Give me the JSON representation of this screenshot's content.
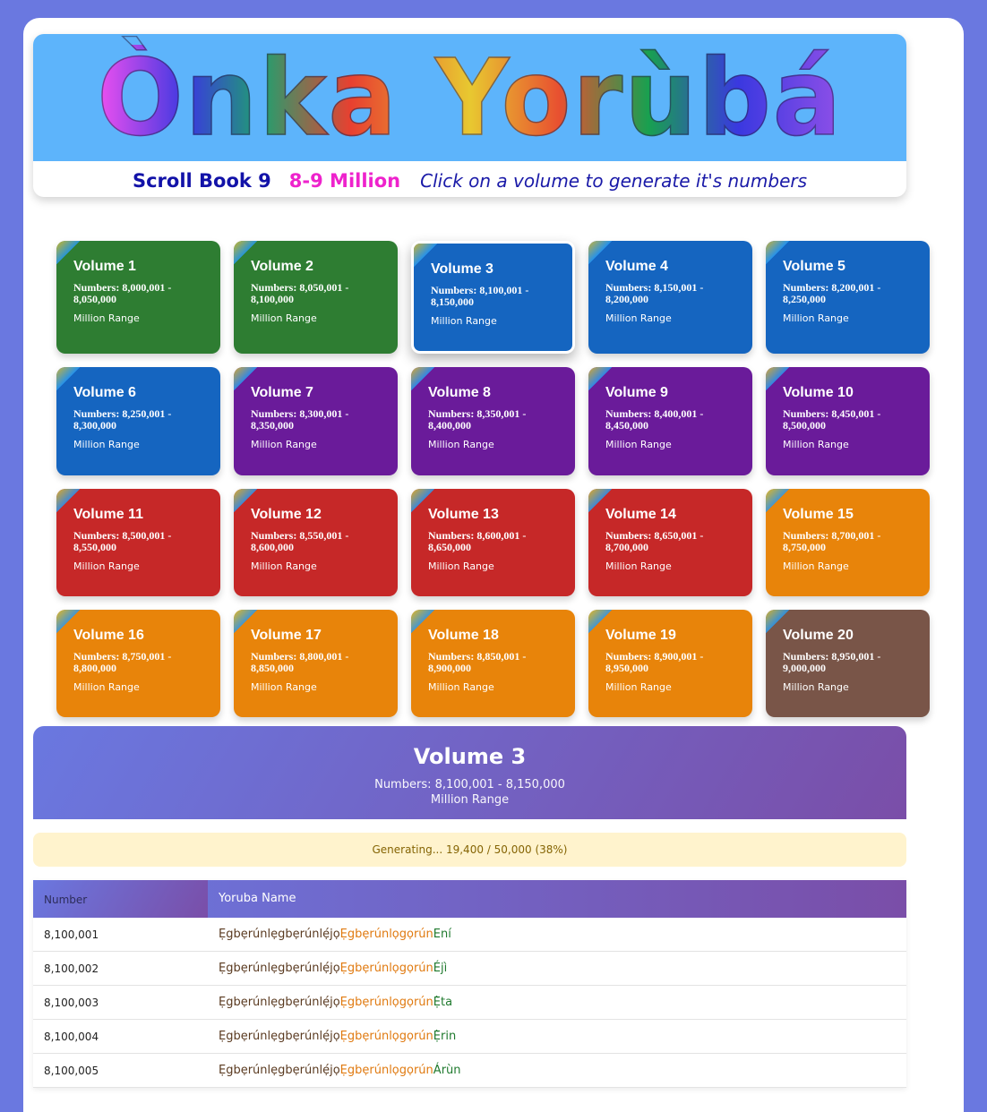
{
  "banner": {
    "logo": "Ònka Yorùbá",
    "book": "Scroll Book 9",
    "range": "8-9 Million",
    "instruction": "Click on a volume to generate it's numbers"
  },
  "volumes": [
    {
      "title": "Volume 1",
      "numbers": "Numbers: 8,000,001 - 8,050,000",
      "range": "Million Range",
      "color": "#2e7d32"
    },
    {
      "title": "Volume 2",
      "numbers": "Numbers: 8,050,001 - 8,100,000",
      "range": "Million Range",
      "color": "#2e7d32"
    },
    {
      "title": "Volume 3",
      "numbers": "Numbers: 8,100,001 - 8,150,000",
      "range": "Million Range",
      "color": "#1565c0"
    },
    {
      "title": "Volume 4",
      "numbers": "Numbers: 8,150,001 - 8,200,000",
      "range": "Million Range",
      "color": "#1565c0"
    },
    {
      "title": "Volume 5",
      "numbers": "Numbers: 8,200,001 - 8,250,000",
      "range": "Million Range",
      "color": "#1565c0"
    },
    {
      "title": "Volume 6",
      "numbers": "Numbers: 8,250,001 - 8,300,000",
      "range": "Million Range",
      "color": "#1565c0"
    },
    {
      "title": "Volume 7",
      "numbers": "Numbers: 8,300,001 - 8,350,000",
      "range": "Million Range",
      "color": "#6a1b9a"
    },
    {
      "title": "Volume 8",
      "numbers": "Numbers: 8,350,001 - 8,400,000",
      "range": "Million Range",
      "color": "#6a1b9a"
    },
    {
      "title": "Volume 9",
      "numbers": "Numbers: 8,400,001 - 8,450,000",
      "range": "Million Range",
      "color": "#6a1b9a"
    },
    {
      "title": "Volume 10",
      "numbers": "Numbers: 8,450,001 - 8,500,000",
      "range": "Million Range",
      "color": "#6a1b9a"
    },
    {
      "title": "Volume 11",
      "numbers": "Numbers: 8,500,001 - 8,550,000",
      "range": "Million Range",
      "color": "#c62828"
    },
    {
      "title": "Volume 12",
      "numbers": "Numbers: 8,550,001 - 8,600,000",
      "range": "Million Range",
      "color": "#c62828"
    },
    {
      "title": "Volume 13",
      "numbers": "Numbers: 8,600,001 - 8,650,000",
      "range": "Million Range",
      "color": "#c62828"
    },
    {
      "title": "Volume 14",
      "numbers": "Numbers: 8,650,001 - 8,700,000",
      "range": "Million Range",
      "color": "#c62828"
    },
    {
      "title": "Volume 15",
      "numbers": "Numbers: 8,700,001 - 8,750,000",
      "range": "Million Range",
      "color": "#e8840a"
    },
    {
      "title": "Volume 16",
      "numbers": "Numbers: 8,750,001 - 8,800,000",
      "range": "Million Range",
      "color": "#e8840a"
    },
    {
      "title": "Volume 17",
      "numbers": "Numbers: 8,800,001 - 8,850,000",
      "range": "Million Range",
      "color": "#e8840a"
    },
    {
      "title": "Volume 18",
      "numbers": "Numbers: 8,850,001 - 8,900,000",
      "range": "Million Range",
      "color": "#e8840a"
    },
    {
      "title": "Volume 19",
      "numbers": "Numbers: 8,900,001 - 8,950,000",
      "range": "Million Range",
      "color": "#e8840a"
    },
    {
      "title": "Volume 20",
      "numbers": "Numbers: 8,950,001 - 9,000,000",
      "range": "Million Range",
      "color": "#795548"
    }
  ],
  "selected_volume": {
    "title": "Volume 3",
    "numbers": "Numbers: 8,100,001 - 8,150,000",
    "range": "Million Range"
  },
  "progress": {
    "text": "Generating... 19,400 / 50,000 (38%)",
    "fraction": 0.38
  },
  "table": {
    "headers": {
      "number": "Number",
      "name": "Yoruba Name"
    },
    "rows": [
      {
        "number": "8,100,001",
        "p1": "Ẹgbẹrúnlẹgbẹrúnlẹ́jọ",
        "p2": "Ẹgbẹrúnlọgọrún",
        "p3": "Ení"
      },
      {
        "number": "8,100,002",
        "p1": "Ẹgbẹrúnlẹgbẹrúnlẹ́jọ",
        "p2": "Ẹgbẹrúnlọgọrún",
        "p3": "Éjì"
      },
      {
        "number": "8,100,003",
        "p1": "Ẹgbẹrúnlẹgbẹrúnlẹ́jọ",
        "p2": "Ẹgbẹrúnlọgọrún",
        "p3": "Ẹ̀ta"
      },
      {
        "number": "8,100,004",
        "p1": "Ẹgbẹrúnlẹgbẹrúnlẹ́jọ",
        "p2": "Ẹgbẹrúnlọgọrún",
        "p3": "Ẹ̀rin"
      },
      {
        "number": "8,100,005",
        "p1": "Ẹgbẹrúnlẹgbẹrúnlẹ́jọ",
        "p2": "Ẹgbẹrúnlọgọrún",
        "p3": "Árùn"
      }
    ]
  }
}
